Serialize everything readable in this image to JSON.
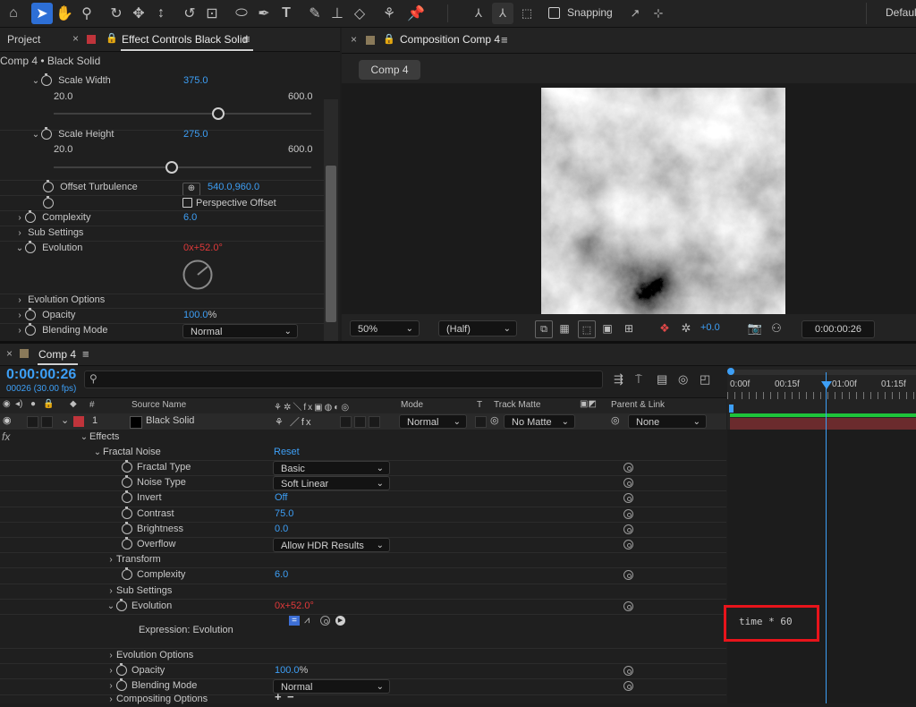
{
  "toolbar": {
    "snapping_label": "Snapping",
    "workspace_label": "Defaul",
    "tools": [
      "home-icon",
      "selection-icon",
      "hand-icon",
      "zoom-icon",
      "orbit-icon",
      "pan-icon",
      "dolly-icon",
      "rotate-icon",
      "anchor-icon",
      "ellipse-icon",
      "pen-icon",
      "type-icon",
      "brush-icon",
      "clone-stamp-icon",
      "eraser-icon",
      "roto-brush-icon",
      "puppet-pin-icon"
    ]
  },
  "effect_controls": {
    "tab_project": "Project",
    "tab_effect": "Effect Controls Black Solid",
    "subtitle": "Comp 4 • Black Solid",
    "scale_width": {
      "label": "Scale Width",
      "value": "375.0",
      "min": "20.0",
      "max": "600.0",
      "fraction": 0.64
    },
    "scale_height": {
      "label": "Scale Height",
      "value": "275.0",
      "min": "20.0",
      "max": "600.0",
      "fraction": 0.46
    },
    "offset_turbulence": {
      "label": "Offset Turbulence",
      "value": "540.0,960.0"
    },
    "perspective_offset": "Perspective Offset",
    "complexity": {
      "label": "Complexity",
      "value": "6.0"
    },
    "sub_settings": "Sub Settings",
    "evolution": {
      "label": "Evolution",
      "rev": "0x",
      "deg": "+52.0°"
    },
    "evolution_options": "Evolution Options",
    "opacity": {
      "label": "Opacity",
      "value": "100.0",
      "unit": "%"
    },
    "blending_mode": {
      "label": "Blending Mode",
      "value": "Normal"
    }
  },
  "composition": {
    "tab_label": "Composition Comp 4",
    "comp_button": "Comp 4",
    "zoom": "50%",
    "resolution": "(Half)",
    "exposure": "+0.0",
    "timecode": "0:00:00:26"
  },
  "timeline": {
    "tab_label": "Comp 4",
    "timecode": "0:00:00:26",
    "frame_info": "00026 (30.00 fps)",
    "ruler": [
      "0:00f",
      "00:15f",
      "01:00f",
      "01:15f"
    ],
    "headers": {
      "num": "#",
      "source": "Source Name",
      "mode": "Mode",
      "t": "T",
      "track_matte": "Track Matte",
      "parent": "Parent & Link"
    },
    "layer": {
      "num": "1",
      "name": "Black Solid",
      "mode": "Normal",
      "matte": "No Matte",
      "parent": "None"
    },
    "effects_label": "Effects",
    "fx_label": "fx",
    "fractal_noise": "Fractal Noise",
    "reset": "Reset",
    "props": [
      {
        "label": "Fractal Type",
        "value": "Basic",
        "kind": "dropdown"
      },
      {
        "label": "Noise Type",
        "value": "Soft Linear",
        "kind": "dropdown"
      },
      {
        "label": "Invert",
        "value": "Off",
        "kind": "value"
      },
      {
        "label": "Contrast",
        "value": "75.0",
        "kind": "value"
      },
      {
        "label": "Brightness",
        "value": "0.0",
        "kind": "value"
      },
      {
        "label": "Overflow",
        "value": "Allow HDR Results",
        "kind": "dropdown"
      }
    ],
    "transform": "Transform",
    "complexity": {
      "label": "Complexity",
      "value": "6.0"
    },
    "sub_settings": "Sub Settings",
    "evolution": {
      "label": "Evolution",
      "rev": "0x",
      "deg": "+52.0°"
    },
    "expression_label": "Expression: Evolution",
    "expression_text": "time * 60",
    "evolution_options": "Evolution Options",
    "opacity": {
      "label": "Opacity",
      "value": "100.0",
      "unit": "%"
    },
    "blending_mode": {
      "label": "Blending Mode",
      "value": "Normal"
    },
    "compositing_options": "Compositing Options"
  },
  "colors": {
    "accent": "#3d9ff6",
    "value_red": "#e0393a",
    "highlight_box": "#e8141b",
    "layer_bar": "#6b2b2d",
    "work_area": "#1ec43a"
  }
}
